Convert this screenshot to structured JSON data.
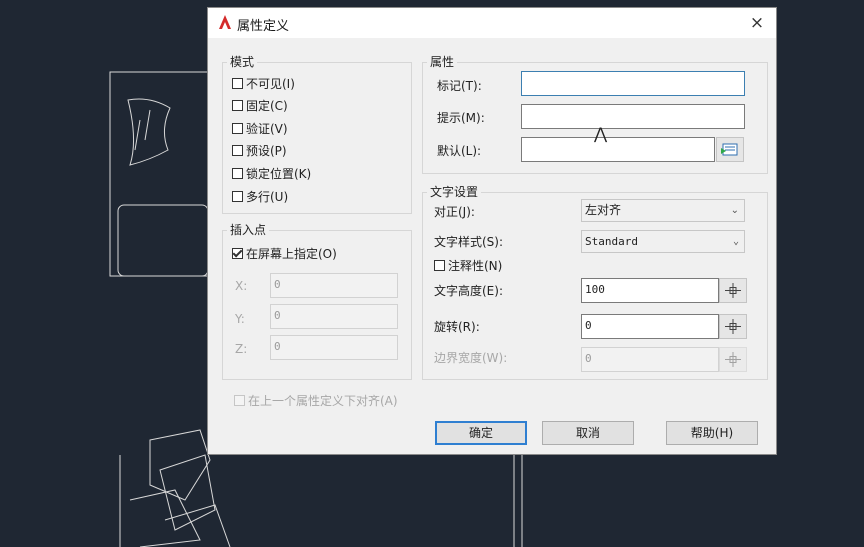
{
  "dialog": {
    "title": "属性定义",
    "close_label": "×"
  },
  "mode": {
    "label": "模式",
    "options": [
      {
        "label": "不可见(I)",
        "checked": false
      },
      {
        "label": "固定(C)",
        "checked": false
      },
      {
        "label": "验证(V)",
        "checked": false
      },
      {
        "label": "预设(P)",
        "checked": false
      },
      {
        "label": "锁定位置(K)",
        "checked": false
      },
      {
        "label": "多行(U)",
        "checked": false
      }
    ]
  },
  "attribute": {
    "label": "属性",
    "tag_label": "标记(T):",
    "tag_value": "",
    "prompt_label": "提示(M):",
    "prompt_value": "",
    "default_label": "默认(L):",
    "default_value": ""
  },
  "insertion": {
    "label": "插入点",
    "specify_label": "在屏幕上指定(O)",
    "specify_checked": true,
    "x_label": "X:",
    "x_value": "0",
    "y_label": "Y:",
    "y_value": "0",
    "z_label": "Z:",
    "z_value": "0"
  },
  "text": {
    "label": "文字设置",
    "justify_label": "对正(J):",
    "justify_value": "左对齐",
    "style_label": "文字样式(S):",
    "style_value": "Standard",
    "annotative_label": "注释性(N)",
    "height_label": "文字高度(E):",
    "height_value": "100",
    "rotation_label": "旋转(R):",
    "rotation_value": "0",
    "boundary_label": "边界宽度(W):",
    "boundary_value": "0"
  },
  "align_below_label": "在上一个属性定义下对齐(A)",
  "buttons": {
    "ok": "确定",
    "cancel": "取消",
    "help": "帮助(H)"
  },
  "colors": {
    "canvas_bg": "#1f2733",
    "dialog_bg": "#f0f0f0",
    "accent": "#2f7fd1",
    "app_icon": "#d42b2b"
  }
}
